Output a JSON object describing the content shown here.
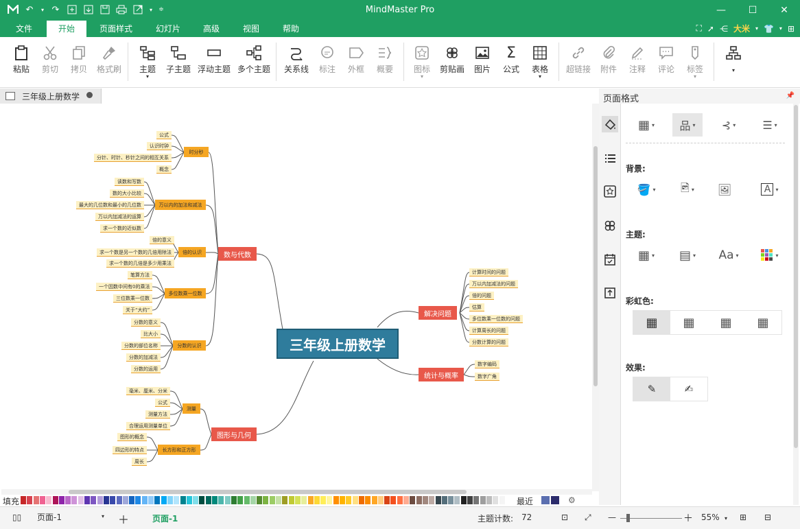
{
  "app": {
    "title": "MindMaster Pro"
  },
  "menu": {
    "items": [
      "文件",
      "开始",
      "页面样式",
      "幻灯片",
      "高级",
      "视图",
      "帮助"
    ],
    "active": "开始",
    "user": "大米"
  },
  "ribbon": {
    "buttons": [
      "粘贴",
      "剪切",
      "拷贝",
      "格式刷",
      "主题",
      "子主题",
      "浮动主题",
      "多个主题",
      "关系线",
      "标注",
      "外框",
      "概要",
      "图标",
      "剪贴画",
      "图片",
      "公式",
      "表格",
      "超链接",
      "附件",
      "注释",
      "评论",
      "标签"
    ]
  },
  "doc_tab": {
    "title": "三年级上册数学"
  },
  "panel": {
    "title": "页面格式",
    "background": "背景:",
    "theme": "主题:",
    "rainbow": "彩虹色:",
    "effects": "效果:"
  },
  "mindmap": {
    "root": "三年级上册数学",
    "main": {
      "num": "数与代数",
      "geo": "图形与几何",
      "solve": "解决问题",
      "stat": "统计与概率"
    },
    "subs": {
      "time": "时分秒",
      "wan": "万以内的加法和减法",
      "bei": "倍的认识",
      "duo": "多位数乘一位数",
      "fen": "分数的认识",
      "measure": "测量",
      "rect": "长方形和正方形"
    },
    "leaves": {
      "time": [
        "公式",
        "认识时钟",
        "分针、时针、秒针之间的相互关系",
        "概念"
      ],
      "wan": [
        "读数和写数",
        "数的大小比较",
        "最大的几位数和最小的几位数",
        "万以内加减法的运算",
        "求一个数的近似数"
      ],
      "bei": [
        "倍的意义",
        "求一个数是另一个数的几倍用除法",
        "求一个数的几倍是多少用乘法"
      ],
      "duo": [
        "笔算方法",
        "一个因数中间有0的乘法",
        "三位数乘一位数",
        "关于“大约”"
      ],
      "fen": [
        "分数的意义",
        "比大小",
        "分数的部位名称",
        "分数的加减法",
        "分数的运用"
      ],
      "measure": [
        "毫米、厘米、分米",
        "公式",
        "测量方法",
        "合理运用测量单位"
      ],
      "rect": [
        "图形的概念",
        "四边形的特点",
        "周长"
      ],
      "solve": [
        "计算时间的问题",
        "万以内加减法的问题",
        "倍的问题",
        "估算",
        "多位数乘一位数的问题",
        "计算周长的问题",
        "分数计算的问题"
      ],
      "stat": [
        "数字编码",
        "数字广角"
      ]
    }
  },
  "colorbar": {
    "fill": "填充",
    "recent": "最近"
  },
  "status": {
    "page_select": "页面-1",
    "page_tab": "页面-1",
    "count_label": "主题计数:",
    "count": "72",
    "zoom": "55%"
  }
}
